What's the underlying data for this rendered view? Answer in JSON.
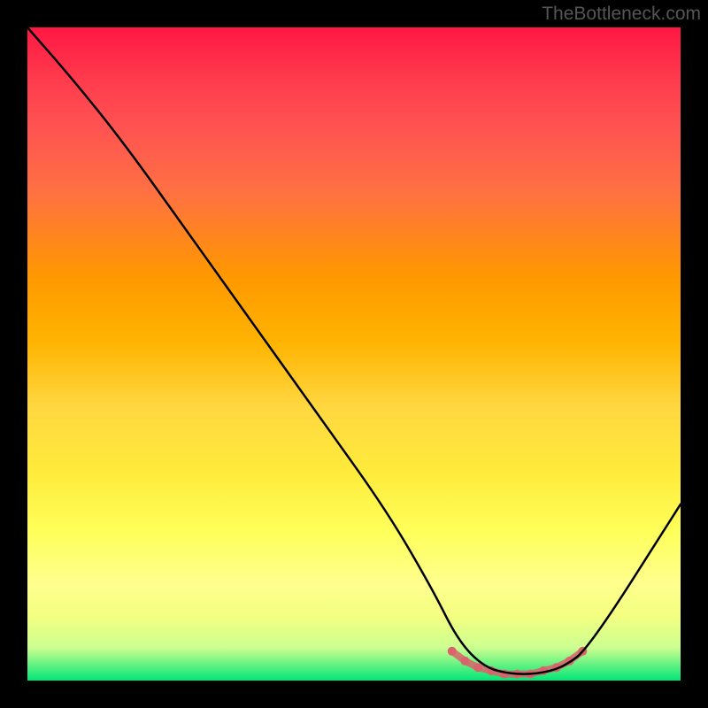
{
  "watermark": "TheBottleneck.com",
  "chart_data": {
    "type": "line",
    "title": "",
    "xlabel": "",
    "ylabel": "",
    "xlim": [
      0,
      100
    ],
    "ylim": [
      0,
      100
    ],
    "series": [
      {
        "name": "bottleneck-curve",
        "x": [
          0,
          7,
          15,
          25,
          35,
          45,
          55,
          62,
          66,
          70,
          74,
          78,
          82,
          86,
          100
        ],
        "y": [
          100,
          92,
          82,
          68,
          54,
          40,
          26,
          14,
          6,
          2,
          1,
          1,
          2,
          5,
          27
        ]
      }
    ],
    "markers": {
      "name": "optimal-range",
      "x": [
        65,
        67,
        69,
        71,
        73,
        75,
        77,
        79,
        81,
        83,
        85
      ],
      "y": [
        4.5,
        3,
        2,
        1.5,
        1,
        1,
        1,
        1.5,
        2,
        3,
        4.5
      ],
      "color": "#d9646b"
    }
  }
}
